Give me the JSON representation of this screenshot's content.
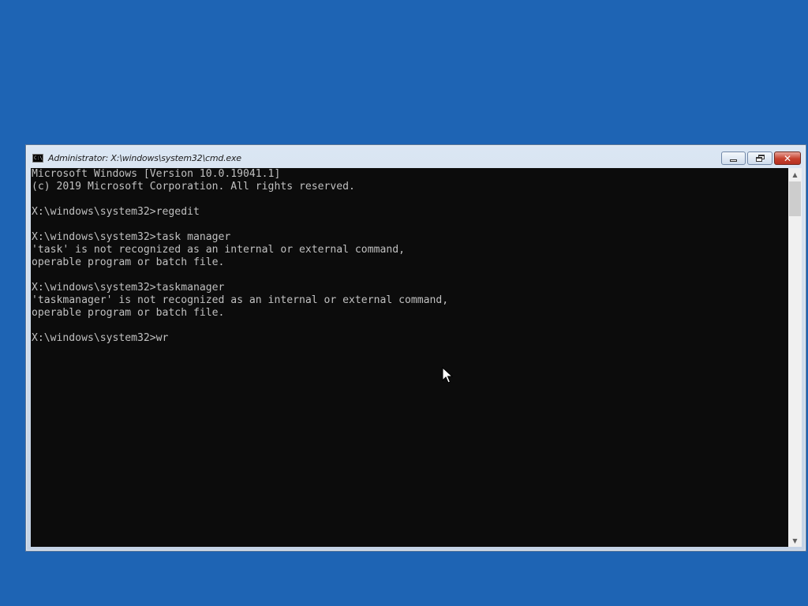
{
  "window": {
    "title": "Administrator: X:\\windows\\system32\\cmd.exe",
    "icon": "cmd-icon",
    "icon_glyph": "C:\\",
    "controls": {
      "minimize": "minimize-icon",
      "restore": "restore-icon",
      "close_label": "✕"
    }
  },
  "console": {
    "text_color": "#c0c0c0",
    "background": "#0c0c0c",
    "lines": [
      "Microsoft Windows [Version 10.0.19041.1]",
      "(c) 2019 Microsoft Corporation. All rights reserved.",
      "",
      "X:\\windows\\system32>regedit",
      "",
      "X:\\windows\\system32>task manager",
      "'task' is not recognized as an internal or external command,",
      "operable program or batch file.",
      "",
      "X:\\windows\\system32>taskmanager",
      "'taskmanager' is not recognized as an internal or external command,",
      "operable program or batch file.",
      "",
      "X:\\windows\\system32>wr"
    ]
  },
  "scrollbar": {
    "up_arrow": "▲",
    "down_arrow": "▼"
  },
  "desktop": {
    "background": "#1e64b4"
  }
}
